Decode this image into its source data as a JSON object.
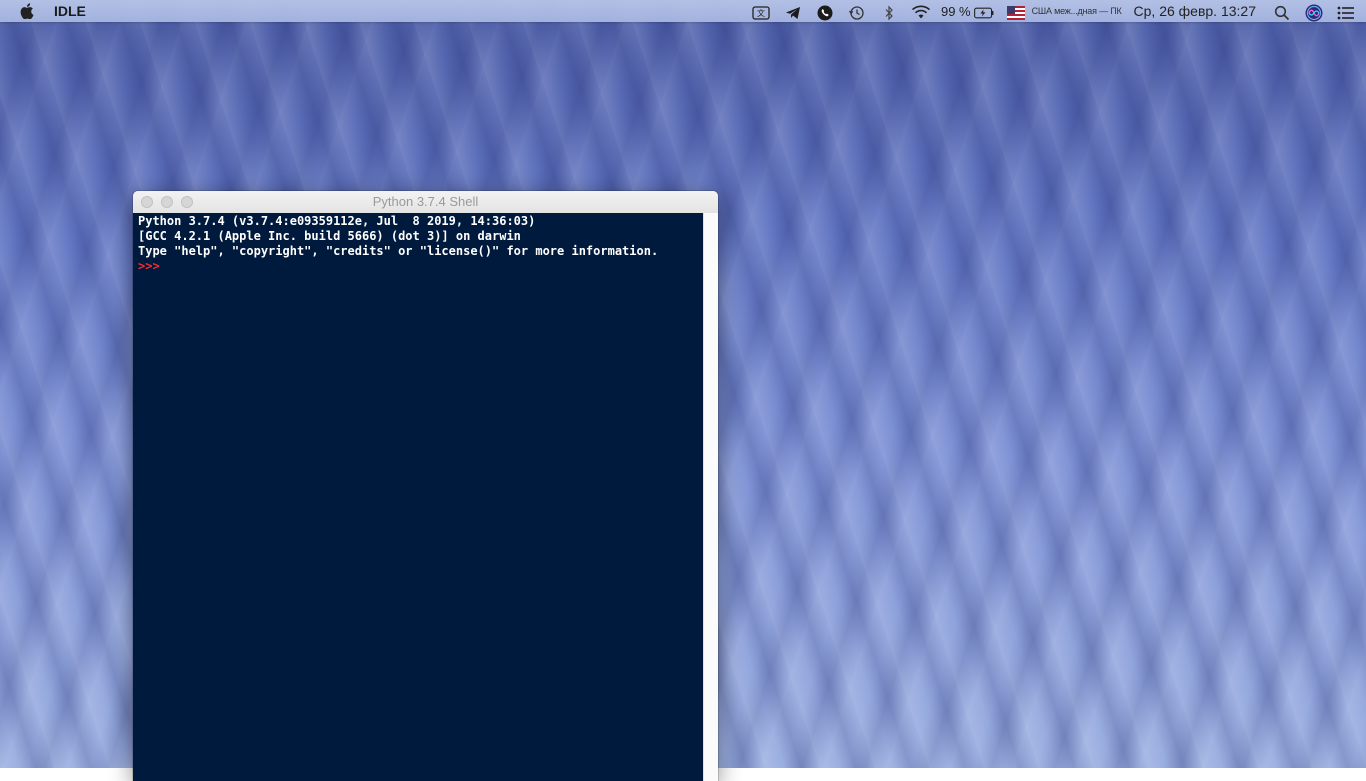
{
  "menubar": {
    "app_name": "IDLE",
    "icons": [
      "apple-icon",
      "language-icon",
      "telegram-icon",
      "viber-icon",
      "time-machine-icon",
      "bluetooth-icon",
      "wifi-icon",
      "battery-icon",
      "flag-icon",
      "search-icon",
      "siri-icon",
      "notification-center-icon"
    ],
    "battery_percent": "99 %",
    "keyboard_layout": "США меж...дная — ПК",
    "clock": "Ср, 26 февр.  13:27"
  },
  "window": {
    "title": "Python 3.7.4 Shell"
  },
  "shell": {
    "lines": [
      "Python 3.7.4 (v3.7.4:e09359112e, Jul  8 2019, 14:36:03) ",
      "[GCC 4.2.1 (Apple Inc. build 5666) (dot 3)] on darwin",
      "Type \"help\", \"copyright\", \"credits\" or \"license()\" for more information."
    ],
    "prompt": ">>> "
  },
  "colors": {
    "shell_background": "#001a3d",
    "shell_text": "#ffffff",
    "prompt": "#ff2a2a"
  }
}
